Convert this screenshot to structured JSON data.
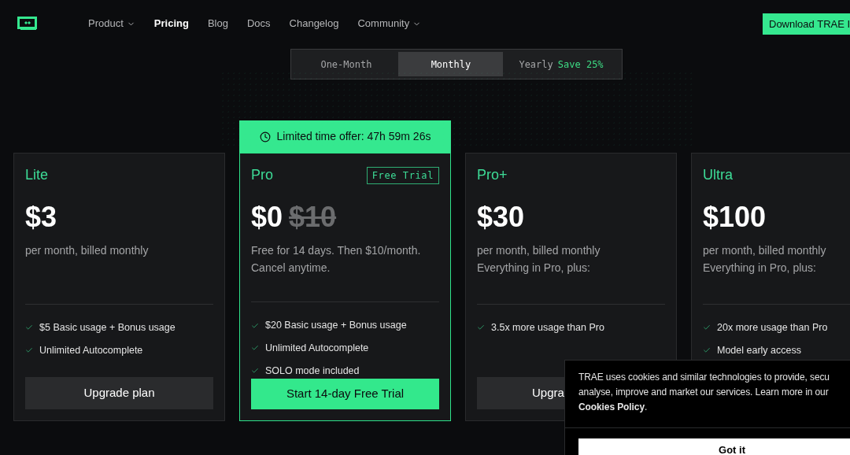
{
  "nav": {
    "items": [
      {
        "label": "Product",
        "dropdown": true,
        "selected": false
      },
      {
        "label": "Pricing",
        "dropdown": false,
        "selected": true
      },
      {
        "label": "Blog",
        "dropdown": false,
        "selected": false
      },
      {
        "label": "Docs",
        "dropdown": false,
        "selected": false
      },
      {
        "label": "Changelog",
        "dropdown": false,
        "selected": false
      },
      {
        "label": "Community",
        "dropdown": true,
        "selected": false
      }
    ],
    "download_button": "Download TRAE I"
  },
  "billing_toggle": [
    {
      "label": "One-Month",
      "selected": false
    },
    {
      "label": "Monthly",
      "selected": true
    },
    {
      "label": "Yearly",
      "badge": "Save 25%",
      "selected": false
    }
  ],
  "plans": [
    {
      "name": "Lite",
      "price": "$3",
      "description": [
        "per month, billed monthly"
      ],
      "features": [
        "$5 Basic usage + Bonus usage",
        "Unlimited Autocomplete"
      ],
      "button": {
        "label": "Upgrade plan",
        "kind": "dark",
        "covered": false
      },
      "highlighted": false
    },
    {
      "name": "Pro",
      "banner": "Limited time offer: 47h 59m 26s",
      "tag": "Free Trial",
      "price": "$0",
      "old_price": "$10",
      "description": [
        "Free for 14 days. Then $10/month.",
        "Cancel anytime."
      ],
      "features": [
        "$20 Basic usage + Bonus usage",
        "Unlimited Autocomplete",
        "SOLO mode included"
      ],
      "button": {
        "label": "Start 14-day Free Trial",
        "kind": "accent",
        "covered": false
      },
      "highlighted": true
    },
    {
      "name": "Pro+",
      "price": "$30",
      "description": [
        "per month, billed monthly",
        "Everything in Pro, plus:"
      ],
      "features": [
        "3.5x more usage than Pro"
      ],
      "button": {
        "label": "Upgra",
        "kind": "dark",
        "covered": true
      },
      "highlighted": false
    },
    {
      "name": "Ultra",
      "price": "$100",
      "description": [
        "per month, billed monthly",
        "Everything in Pro, plus:"
      ],
      "features": [
        "20x more usage than Pro",
        "Model early access"
      ],
      "highlighted": false
    }
  ],
  "cookie_banner": {
    "lines": [
      "TRAE uses cookies and similar technologies to provide, secu",
      "analyse, improve and market our services. Learn more in our",
      "**Cookies Policy**."
    ],
    "button": "Got it"
  }
}
